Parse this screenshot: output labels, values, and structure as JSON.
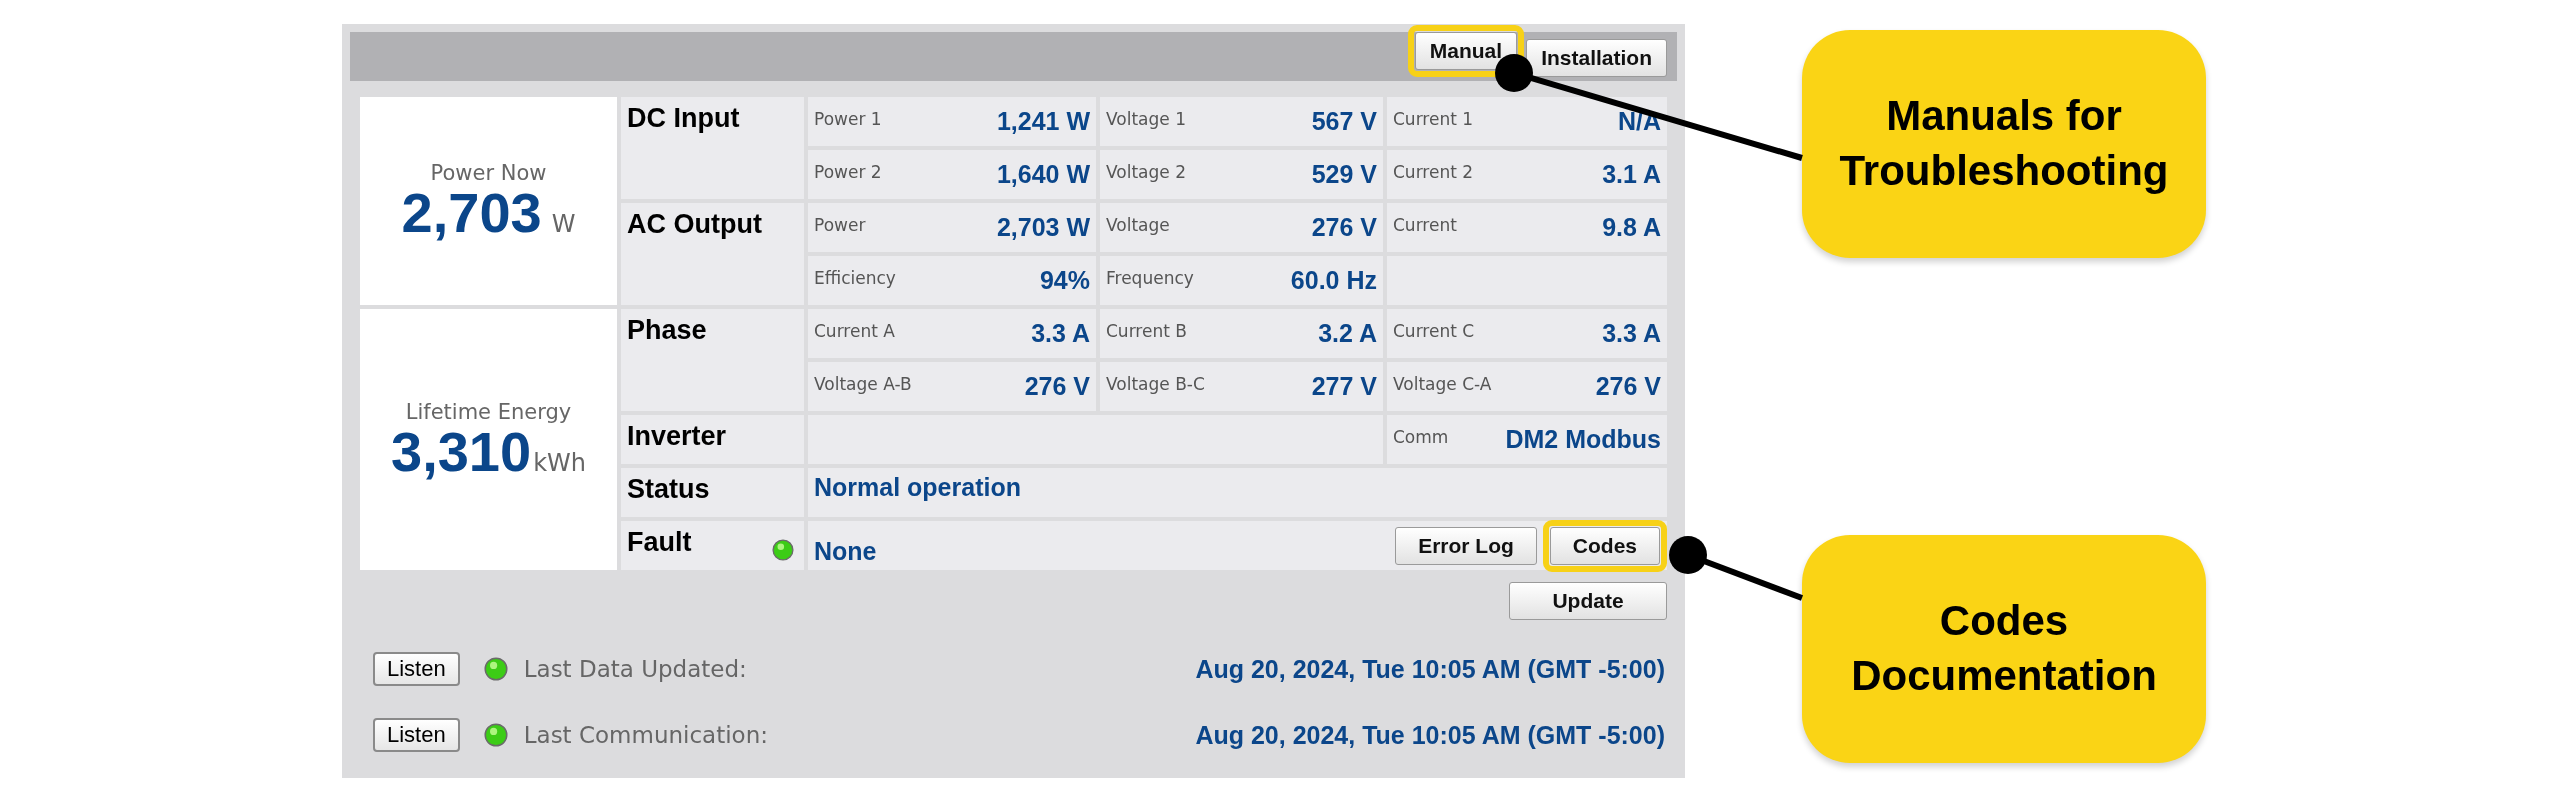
{
  "header_buttons": [
    {
      "label": "Manual",
      "highlighted": true
    },
    {
      "label": "Installation",
      "highlighted": false
    }
  ],
  "power_now": {
    "label": "Power Now",
    "value": "2,703",
    "unit": "W"
  },
  "lifetime_energy": {
    "label": "Lifetime Energy",
    "value": "3,310",
    "unit": "kWh"
  },
  "sections": [
    {
      "kind": "metrics",
      "label": "DC Input",
      "rows": [
        [
          {
            "label": "Power 1",
            "value": "1,241 W"
          },
          {
            "label": "Voltage 1",
            "value": "567 V"
          },
          {
            "label": "Current 1",
            "value": "N/A"
          }
        ],
        [
          {
            "label": "Power 2",
            "value": "1,640 W"
          },
          {
            "label": "Voltage 2",
            "value": "529 V"
          },
          {
            "label": "Current 2",
            "value": "3.1 A"
          }
        ]
      ]
    },
    {
      "kind": "metrics",
      "label": "AC Output",
      "rows": [
        [
          {
            "label": "Power",
            "value": "2,703 W"
          },
          {
            "label": "Voltage",
            "value": "276 V"
          },
          {
            "label": "Current",
            "value": "9.8 A"
          }
        ],
        [
          {
            "label": "Efficiency",
            "value": "94%"
          },
          {
            "label": "Frequency",
            "value": "60.0 Hz"
          }
        ]
      ]
    },
    {
      "kind": "metrics",
      "label": "Phase",
      "rows": [
        [
          {
            "label": "Current A",
            "value": "3.3 A"
          },
          {
            "label": "Current B",
            "value": "3.2 A"
          },
          {
            "label": "Current C",
            "value": "3.3 A"
          }
        ],
        [
          {
            "label": "Voltage A-B",
            "value": "276 V"
          },
          {
            "label": "Voltage B-C",
            "value": "277 V"
          },
          {
            "label": "Voltage C-A",
            "value": "276 V"
          }
        ]
      ]
    },
    {
      "kind": "comm",
      "label": "Inverter",
      "comm": {
        "label": "Comm",
        "value": "DM2 Modbus"
      }
    },
    {
      "kind": "text",
      "label": "Status",
      "value": "Normal operation"
    },
    {
      "kind": "fault",
      "label": "Fault",
      "ok": true,
      "value": "None",
      "buttons": [
        {
          "label": "Error Log",
          "highlighted": false
        },
        {
          "label": "Codes",
          "highlighted": true
        }
      ]
    }
  ],
  "update_button": "Update",
  "status_lines": [
    {
      "button": "Listen",
      "ok": true,
      "label": "Last Data Updated:",
      "value": "Aug 20, 2024, Tue 10:05 AM (GMT -5:00)"
    },
    {
      "button": "Listen",
      "ok": true,
      "label": "Last Communication:",
      "value": "Aug 20, 2024, Tue 10:05 AM (GMT -5:00)"
    }
  ],
  "callouts": [
    {
      "text": "Manuals for Troubleshooting"
    },
    {
      "text": "Codes Documentation"
    }
  ]
}
